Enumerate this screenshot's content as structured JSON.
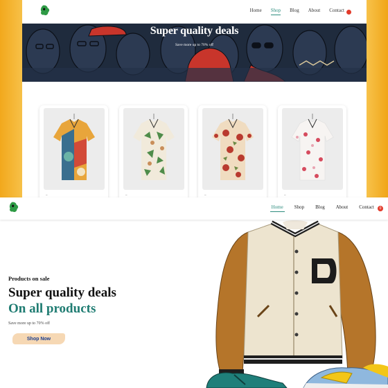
{
  "top": {
    "nav": [
      {
        "label": "Home",
        "active": false
      },
      {
        "label": "Shop",
        "active": true
      },
      {
        "label": "Blog",
        "active": false
      },
      {
        "label": "About",
        "active": false
      },
      {
        "label": "Contact",
        "active": false
      }
    ],
    "hero": {
      "title": "Super quality deals",
      "subtitle": "Save more up to 70% off"
    },
    "products": [
      {
        "name": "patchwork-shirt",
        "palette": [
          "#e8a53b",
          "#3a6f8f",
          "#d24a38",
          "#6bb3a6"
        ]
      },
      {
        "name": "palm-print-shirt",
        "palette": [
          "#f1eadb",
          "#4f8c4a",
          "#8fb06e",
          "#c98e5a"
        ]
      },
      {
        "name": "floral-red-shirt",
        "palette": [
          "#f0dcc0",
          "#b93a2e",
          "#6d8a45",
          "#d96a4a"
        ]
      },
      {
        "name": "white-floral-shirt",
        "palette": [
          "#f7f4f2",
          "#d64b5e",
          "#e9a3b1",
          "#5b7c52"
        ]
      }
    ]
  },
  "bottom": {
    "nav": [
      {
        "label": "Home",
        "active": true
      },
      {
        "label": "Shop",
        "active": false
      },
      {
        "label": "Blog",
        "active": false
      },
      {
        "label": "About",
        "active": false
      },
      {
        "label": "Contact",
        "active": false
      }
    ],
    "cart_count": "0",
    "hero": {
      "eyebrow": "Products on sale",
      "title_line1": "Super quality deals",
      "title_line2": "On all products",
      "subtitle": "Save more up to 70% off",
      "cta": "Shop Now"
    }
  },
  "colors": {
    "accent": "#1f7c72",
    "cart": "#e23b2b",
    "banner": "#f6c247"
  }
}
